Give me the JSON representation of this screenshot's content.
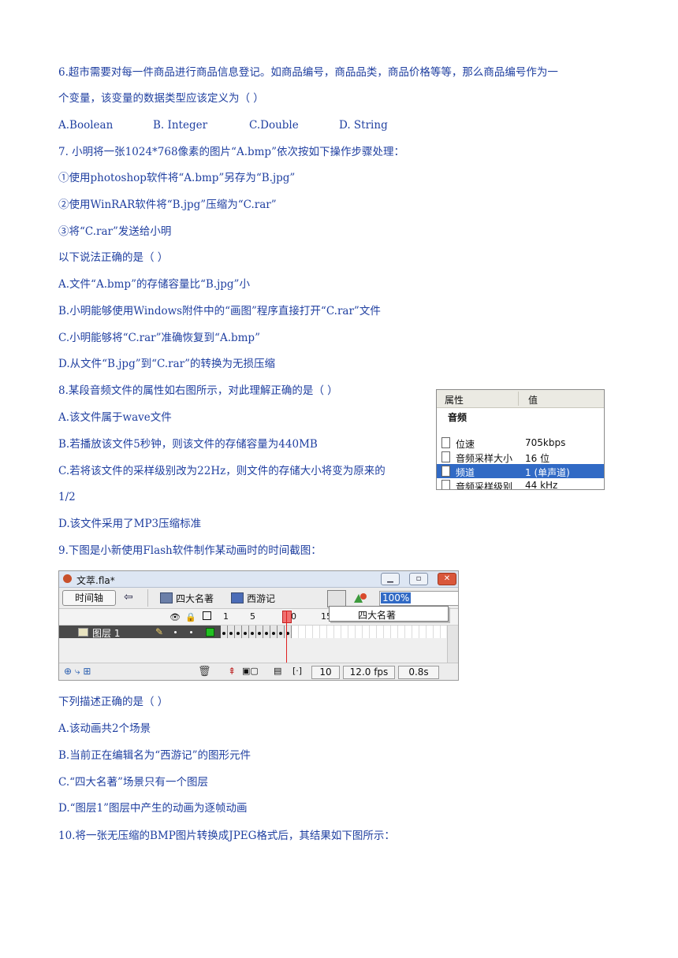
{
  "q6": {
    "line1": "6.超市需要对每一件商品进行商品信息登记。如商品编号，商品品类，商品价格等等，那么商品编号作为一",
    "line2": "个变量，该变量的数据类型应该定义为（ ）",
    "options": [
      "A.Boolean",
      "B. Integer",
      "C.Double",
      "D. String"
    ]
  },
  "q7": {
    "stem": "7. 小明将一张1024*768像素的图片“A.bmp”依次按如下操作步骤处理：",
    "steps": [
      "①使用photoshop软件将“A.bmp”另存为“B.jpg”",
      "②使用WinRAR软件将“B.jpg”压缩为“C.rar”",
      "③将“C.rar”发送给小明"
    ],
    "prompt": "以下说法正确的是（        ）",
    "options": [
      "A.文件“A.bmp”的存储容量比“B.jpg”小",
      "B.小明能够使用Windows附件中的“画图”程序直接打开“C.rar”文件",
      "C.小明能够将“C.rar”准确恢复到“A.bmp”",
      "D.从文件“B.jpg”到“C.rar”的转换为无损压缩"
    ]
  },
  "q8": {
    "stem": "8.某段音频文件的属性如右图所示，对此理解正确的是（     ）",
    "options": [
      "A.该文件属于wave文件",
      "B.若播放该文件5秒钟，则该文件的存储容量为440MB",
      "C.若将该文件的采样级别改为22Hz，则文件的存储大小将变为原来的",
      "1/2",
      "D.该文件采用了MP3压缩标准"
    ],
    "panel": {
      "col_property": "属性",
      "col_value": "值",
      "group": "音频",
      "rows": [
        {
          "name": "位速",
          "value": "705kbps"
        },
        {
          "name": "音频采样大小",
          "value": "16 位"
        },
        {
          "name": "频道",
          "value": "1 (单声道)"
        },
        {
          "name": "音频采样级别",
          "value": "44 kHz"
        }
      ],
      "selected_row": 2
    }
  },
  "q9": {
    "stem": "9.下图是小新使用Flash软件制作某动画时的时间截图：",
    "prompt": "下列描述正确的是（        ）",
    "options": [
      "A.该动画共2个场景",
      "B.当前正在编辑名为“西游记”的图形元件",
      "C.“四大名著”场景只有一个图层",
      "D.“图层1”图层中产生的动画为逐帧动画"
    ],
    "flash": {
      "window_title": "文萃.fla*",
      "timeline_button": "时间轴",
      "crumb_scene": "四大名著",
      "crumb_symbol": "西游记",
      "zoom": "100%",
      "dropdown_item": "四大名著",
      "ruler": [
        "1",
        "5",
        "10",
        "15"
      ],
      "layer_name": "图层 1",
      "frame": "10",
      "fps": "12.0 fps",
      "time": "0.8s",
      "keyframes": 10
    }
  },
  "q10": {
    "stem": "10.将一张无压缩的BMP图片转换成JPEG格式后，其结果如下图所示："
  }
}
